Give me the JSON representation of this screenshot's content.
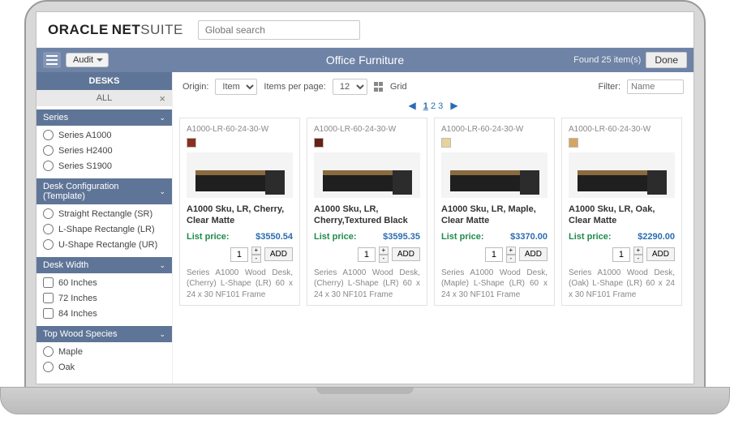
{
  "header": {
    "brand_oracle": "ORACLE",
    "brand_net": "NET",
    "brand_suite": "SUITE",
    "search_placeholder": "Global search"
  },
  "bluebar": {
    "audit_label": "Audit",
    "title": "Office Furniture",
    "found_text": "Found 25 item(s)",
    "done_label": "Done"
  },
  "sidebar": {
    "category": "DESKS",
    "all_label": "ALL",
    "facets": [
      {
        "title": "Series",
        "options": [
          "Series A1000",
          "Series H2400",
          "Series S1900"
        ]
      },
      {
        "title": "Desk Configuration (Template)",
        "options": [
          "Straight Rectangle (SR)",
          "L-Shape Rectangle (LR)",
          "U-Shape Rectangle (UR)"
        ]
      },
      {
        "title": "Desk Width",
        "options": [
          "60 Inches",
          "72 Inches",
          "84 Inches"
        ]
      },
      {
        "title": "Top Wood Species",
        "options": [
          "Maple",
          "Oak"
        ]
      }
    ]
  },
  "toolbar": {
    "origin_label": "Origin:",
    "origin_value": "Item",
    "ipp_label": "Items per page:",
    "ipp_value": "12",
    "grid_label": "Grid",
    "filter_label": "Filter:",
    "filter_placeholder": "Name"
  },
  "pager": {
    "pages": [
      "1",
      "2",
      "3"
    ]
  },
  "labels": {
    "list_price": "List price:",
    "add": "ADD"
  },
  "products": [
    {
      "sku": "A1000-LR-60-24-30-W",
      "swatch": "#8a2f1e",
      "title": "A1000 Sku, LR, Cherry, Clear Matte",
      "price": "$3550.54",
      "qty": "1",
      "desc": "Series A1000 Wood Desk, (Cherry) L-Shape (LR) 60 x 24 x 30 NF101 Frame"
    },
    {
      "sku": "A1000-LR-60-24-30-W",
      "swatch": "#6a2015",
      "title": "A1000 Sku, LR, Cherry,Textured Black",
      "price": "$3595.35",
      "qty": "1",
      "desc": "Series A1000 Wood Desk, (Cherry) L-Shape (LR) 60 x 24 x 30 NF101 Frame"
    },
    {
      "sku": "A1000-LR-60-24-30-W",
      "swatch": "#e7d39a",
      "title": "A1000 Sku, LR, Maple, Clear Matte",
      "price": "$3370.00",
      "qty": "1",
      "desc": "Series A1000 Wood Desk, (Maple) L-Shape (LR) 60 x 24 x 30 NF101 Frame"
    },
    {
      "sku": "A1000-LR-60-24-30-W",
      "swatch": "#d6a560",
      "title": "A1000 Sku, LR, Oak, Clear Matte",
      "price": "$2290.00",
      "qty": "1",
      "desc": "Series A1000 Wood Desk, (Oak) L-Shape (LR) 60 x 24 x 30 NF101 Frame"
    }
  ]
}
